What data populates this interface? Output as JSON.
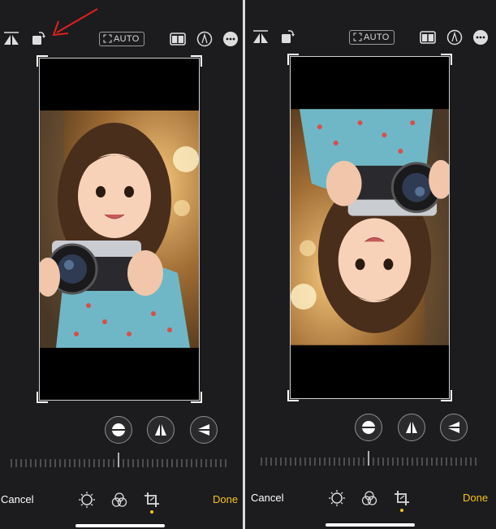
{
  "toolbar": {
    "auto_label": "AUTO"
  },
  "bottom_bar": {
    "cancel_label": "Cancel",
    "done_label": "Done"
  },
  "icons": {
    "top_left": [
      "flip-horizontal-icon",
      "rotate-icon"
    ],
    "top_center": "auto-straighten-icon",
    "top_right": [
      "aspect-ratio-icon",
      "markup-icon",
      "more-icon"
    ],
    "adjust": [
      "straighten-icon",
      "vertical-perspective-icon",
      "horizontal-perspective-icon"
    ],
    "modes": [
      "adjust-icon",
      "filters-icon",
      "crop-icon"
    ]
  },
  "colors": {
    "accent": "#f5c518",
    "annotation_arrow": "#e02020",
    "background": "#1c1c1e"
  }
}
